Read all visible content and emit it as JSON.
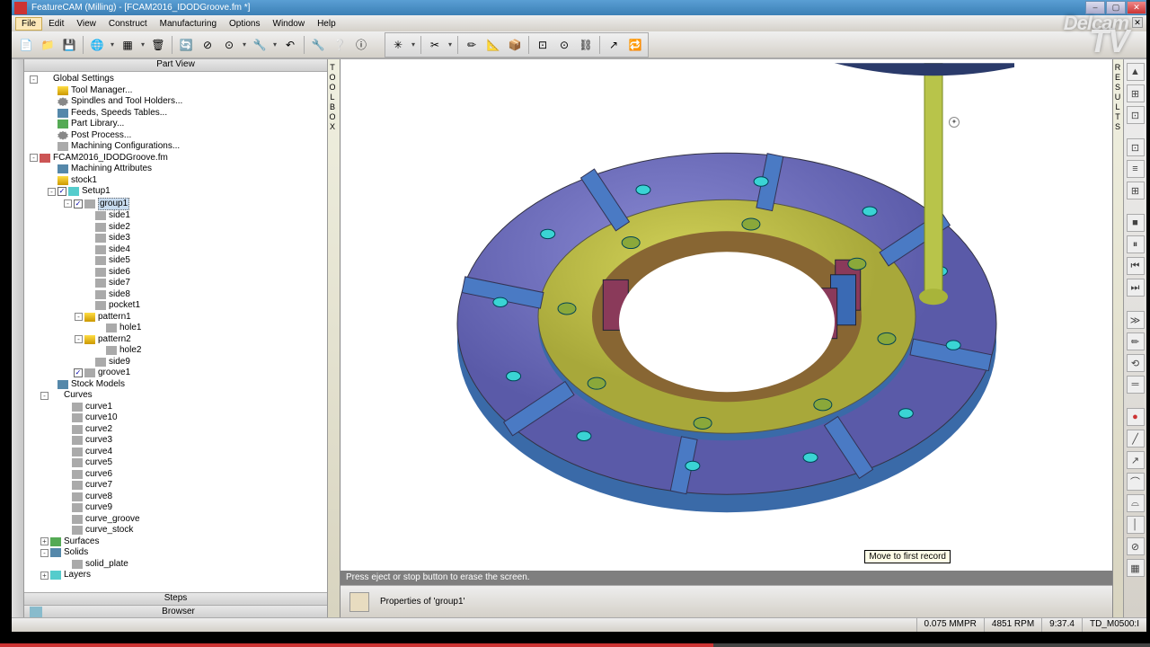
{
  "window": {
    "title": "FeatureCAM (Milling) - [FCAM2016_IDODGroove.fm *]",
    "buttons": {
      "min": "–",
      "max": "▢",
      "close": "✕"
    }
  },
  "menu": {
    "items": [
      "File",
      "Edit",
      "View",
      "Construct",
      "Manufacturing",
      "Options",
      "Window",
      "Help"
    ],
    "highlighted": 0
  },
  "toolbox_label": "TOOLBOX",
  "results_label": "RESULTS",
  "partview": {
    "title": "Part View",
    "nodes": [
      {
        "label": "Global Settings",
        "ind": 4,
        "exp": "-",
        "ico": ""
      },
      {
        "label": "Tool Manager...",
        "ind": 24,
        "ico": "ico-yel"
      },
      {
        "label": "Spindles and Tool Holders...",
        "ind": 24,
        "ico": "ico-gear"
      },
      {
        "label": "Feeds, Speeds Tables...",
        "ind": 24,
        "ico": "ico-blu"
      },
      {
        "label": "Part Library...",
        "ind": 24,
        "ico": "ico-grn"
      },
      {
        "label": "Post Process...",
        "ind": 24,
        "ico": "ico-gear"
      },
      {
        "label": "Machining Configurations...",
        "ind": 24,
        "ico": "ico-gry"
      },
      {
        "label": "FCAM2016_IDODGroove.fm",
        "ind": 4,
        "exp": "-",
        "ico": "ico-red"
      },
      {
        "label": "Machining Attributes",
        "ind": 24,
        "ico": "ico-blu"
      },
      {
        "label": "stock1",
        "ind": 24,
        "ico": "ico-yel"
      },
      {
        "label": "Setup1",
        "ind": 24,
        "exp": "-",
        "chk": true,
        "ico": "ico-cyn"
      },
      {
        "label": "group1",
        "ind": 42,
        "exp": "-",
        "chk": true,
        "ico": "ico-gry",
        "sel": true
      },
      {
        "label": "side1",
        "ind": 66,
        "ico": "ico-gry"
      },
      {
        "label": "side2",
        "ind": 66,
        "ico": "ico-gry"
      },
      {
        "label": "side3",
        "ind": 66,
        "ico": "ico-gry"
      },
      {
        "label": "side4",
        "ind": 66,
        "ico": "ico-gry"
      },
      {
        "label": "side5",
        "ind": 66,
        "ico": "ico-gry"
      },
      {
        "label": "side6",
        "ind": 66,
        "ico": "ico-gry"
      },
      {
        "label": "side7",
        "ind": 66,
        "ico": "ico-gry"
      },
      {
        "label": "side8",
        "ind": 66,
        "ico": "ico-gry"
      },
      {
        "label": "pocket1",
        "ind": 66,
        "ico": "ico-gry"
      },
      {
        "label": "pattern1",
        "ind": 54,
        "exp": "-",
        "ico": "ico-yel"
      },
      {
        "label": "hole1",
        "ind": 78,
        "ico": "ico-gry"
      },
      {
        "label": "pattern2",
        "ind": 54,
        "exp": "-",
        "ico": "ico-yel"
      },
      {
        "label": "hole2",
        "ind": 78,
        "ico": "ico-gry"
      },
      {
        "label": "side9",
        "ind": 66,
        "ico": "ico-gry"
      },
      {
        "label": "groove1",
        "ind": 42,
        "chk": true,
        "ico": "ico-gry"
      },
      {
        "label": "Stock Models",
        "ind": 24,
        "ico": "ico-blu"
      },
      {
        "label": "Curves",
        "ind": 16,
        "exp": "-",
        "ico": ""
      },
      {
        "label": "curve1",
        "ind": 40,
        "ico": "ico-gry"
      },
      {
        "label": "curve10",
        "ind": 40,
        "ico": "ico-gry"
      },
      {
        "label": "curve2",
        "ind": 40,
        "ico": "ico-gry"
      },
      {
        "label": "curve3",
        "ind": 40,
        "ico": "ico-gry"
      },
      {
        "label": "curve4",
        "ind": 40,
        "ico": "ico-gry"
      },
      {
        "label": "curve5",
        "ind": 40,
        "ico": "ico-gry"
      },
      {
        "label": "curve6",
        "ind": 40,
        "ico": "ico-gry"
      },
      {
        "label": "curve7",
        "ind": 40,
        "ico": "ico-gry"
      },
      {
        "label": "curve8",
        "ind": 40,
        "ico": "ico-gry"
      },
      {
        "label": "curve9",
        "ind": 40,
        "ico": "ico-gry"
      },
      {
        "label": "curve_groove",
        "ind": 40,
        "ico": "ico-gry"
      },
      {
        "label": "curve_stock",
        "ind": 40,
        "ico": "ico-gry"
      },
      {
        "label": "Surfaces",
        "ind": 16,
        "exp": "+",
        "ico": "ico-grn"
      },
      {
        "label": "Solids",
        "ind": 16,
        "exp": "-",
        "ico": "ico-blu"
      },
      {
        "label": "solid_plate",
        "ind": 40,
        "ico": "ico-gry"
      },
      {
        "label": "Layers",
        "ind": 16,
        "exp": "+",
        "ico": "ico-cyn"
      }
    ],
    "tabs": {
      "steps": "Steps",
      "browser": "Browser"
    }
  },
  "viewport": {
    "message": "Press eject or stop button to erase the screen.",
    "tooltip": "Move to first record",
    "properties": "Properties of 'group1'"
  },
  "status": {
    "feed": "0.075 MMPR",
    "rpm": "4851 RPM",
    "time": "9:37.4",
    "tool": "TD_M0500:I"
  },
  "logo": {
    "line1": "Delcam",
    "line2": "TV"
  },
  "toolbar_icons": [
    "📄",
    "📁",
    "💾",
    "",
    "🌐",
    "▾",
    "▦",
    "▾",
    "🗑",
    "",
    "🔄",
    "⊘",
    "⊙",
    "▾",
    "🔧",
    "▾",
    "↶",
    "",
    "🔧",
    "❔",
    "ⓘ"
  ],
  "toolbar2_icons": [
    "✳",
    "▾",
    "",
    "✂",
    "▾",
    "",
    "✏",
    "📐",
    "📦",
    "",
    "⊡",
    "⊙",
    "⛓",
    "",
    "↗",
    "🔁"
  ],
  "right_icons": [
    "▲",
    "⊞",
    "⊡",
    "",
    "⊡",
    "≡",
    "⊞",
    "",
    "■",
    "⏸",
    "⏮",
    "⏭",
    "",
    "≫",
    "✏",
    "⟲",
    "═",
    "",
    "●",
    "╱",
    "↗",
    "⌒",
    "⌓",
    "│",
    "⊘",
    "▦"
  ]
}
